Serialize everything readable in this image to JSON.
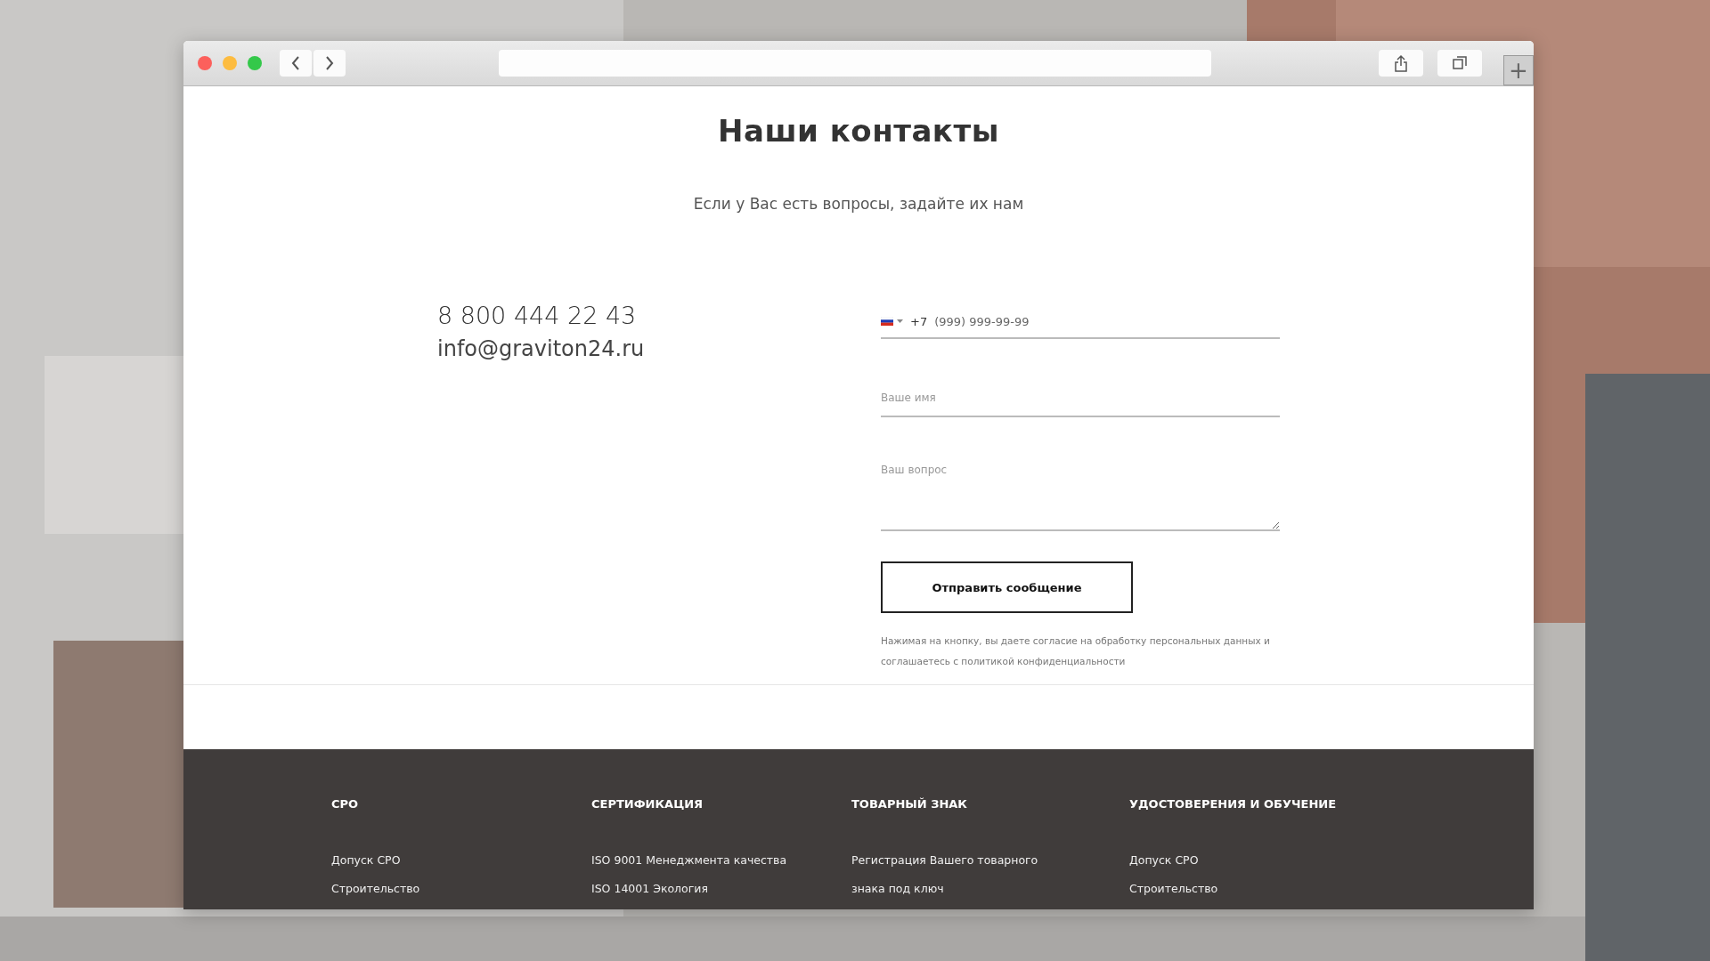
{
  "toolbar": {
    "plus": "+"
  },
  "page": {
    "title": "Наши контакты",
    "subtitle": "Если у Вас есть вопросы, задайте их нам",
    "phone": "8 800 444 22 43",
    "email": "info@graviton24.ru"
  },
  "form": {
    "phone_code": "+7",
    "phone_placeholder": "(999) 999-99-99",
    "name_placeholder": "Ваше имя",
    "question_placeholder": "Ваш вопрос",
    "submit": "Отправить сообщение",
    "consent": "Нажимая на кнопку, вы даете согласие на обработку персональных данных и соглашаетесь с политикой конфиденциальности"
  },
  "footer": {
    "columns": [
      {
        "heading": "СРО",
        "links": [
          "Допуск СРО",
          "Строительство"
        ]
      },
      {
        "heading": "СЕРТИФИКАЦИЯ",
        "links": [
          "ISO 9001 Менеджмента качества",
          "ISO 14001 Экология"
        ]
      },
      {
        "heading": "ТОВАРНЫЙ ЗНАК",
        "links": [
          "Регистрация Вашего товарного знака под ключ"
        ]
      },
      {
        "heading": "УДОСТОВЕРЕНИЯ И ОБУЧЕНИЕ",
        "links": [
          "Допуск СРО",
          "Строительство"
        ]
      }
    ]
  }
}
